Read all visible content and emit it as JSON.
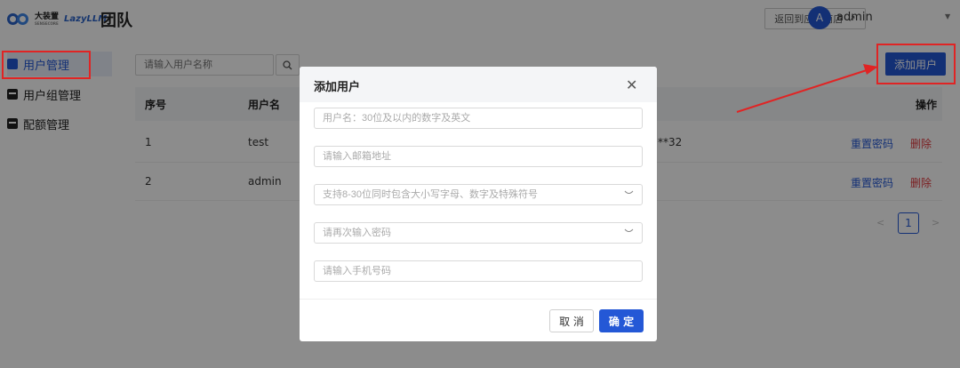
{
  "header": {
    "logo_cn": "大装置",
    "logo_sub": "SENSECORE",
    "logo_brand": "LazyLLM",
    "page_title": "团队",
    "back_to_store": "返回到应用商店",
    "back_icon": "external-link-icon",
    "avatar_initial": "A",
    "user_name": "admin",
    "user_chevron": "⌄"
  },
  "sidebar": {
    "items": [
      {
        "label": "用户管理",
        "icon": "user-stack-icon",
        "active": true
      },
      {
        "label": "用户组管理",
        "icon": "group-icon",
        "active": false
      },
      {
        "label": "配额管理",
        "icon": "quota-icon",
        "active": false
      }
    ]
  },
  "toolbar": {
    "search_placeholder": "请输入用户名称",
    "search_icon": "🔍",
    "add_user_label": "添加用户"
  },
  "table": {
    "columns": [
      "序号",
      "用户名",
      "操作"
    ],
    "rows": [
      {
        "index": "1",
        "username": "test",
        "hidden_fragment": "**32",
        "reset": "重置密码",
        "delete": "删除"
      },
      {
        "index": "2",
        "username": "admin",
        "hidden_fragment": "",
        "reset": "重置密码",
        "delete": "删除"
      }
    ]
  },
  "pagination": {
    "prev": "<",
    "current": "1",
    "next": ">"
  },
  "modal": {
    "title": "添加用户",
    "close_symbol": "✕",
    "fields": [
      {
        "placeholder": "用户名：30位及以内的数字及英文",
        "type": "text"
      },
      {
        "placeholder": "请输入邮箱地址",
        "type": "text"
      },
      {
        "placeholder": "支持8-30位同时包含大小写字母、数字及特殊符号",
        "type": "password"
      },
      {
        "placeholder": "请再次输入密码",
        "type": "password"
      },
      {
        "placeholder": "请输入手机号码",
        "type": "text"
      }
    ],
    "eye_symbol": "⌣",
    "cancel_label": "取 消",
    "confirm_label": "确 定"
  },
  "colors": {
    "primary": "#2458d6",
    "danger": "#e0393e",
    "annotation_red": "#e02424"
  }
}
